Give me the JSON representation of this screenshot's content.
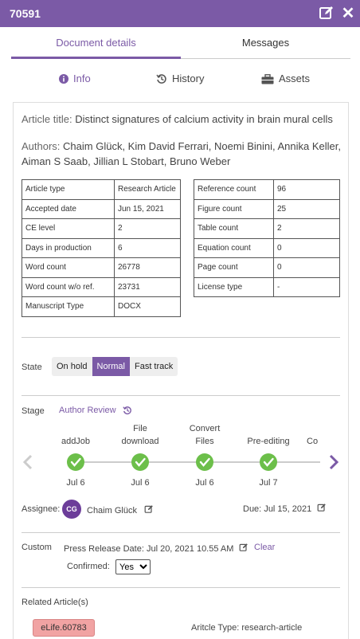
{
  "window": {
    "doc_id": "70591"
  },
  "tabs": [
    {
      "label": "Document details",
      "active": true
    },
    {
      "label": "Messages",
      "active": false
    }
  ],
  "subtabs": [
    {
      "label": "Info",
      "icon": "info-icon",
      "active": true
    },
    {
      "label": "History",
      "icon": "history-icon",
      "active": false
    },
    {
      "label": "Assets",
      "icon": "briefcase-icon",
      "active": false
    }
  ],
  "article": {
    "title_label": "Article title:",
    "title": "Distinct signatures of calcium activity in brain mural cells",
    "authors_label": "Authors:",
    "authors": "Chaim Glück, Kim David Ferrari, Noemi Binini, Annika Keller, Aiman S Saab, Jillian L Stobart, Bruno Weber"
  },
  "left_table": [
    [
      "Article type",
      "Research Article"
    ],
    [
      "Accepted date",
      "Jun 15, 2021"
    ],
    [
      "CE level",
      "2"
    ],
    [
      "Days in production",
      "6"
    ],
    [
      "Word count",
      "26778"
    ],
    [
      "Word count w/o ref.",
      "23731"
    ],
    [
      "Manuscript Type",
      "DOCX"
    ]
  ],
  "right_table": [
    [
      "Reference count",
      "96"
    ],
    [
      "Figure count",
      "25"
    ],
    [
      "Table count",
      "2"
    ],
    [
      "Equation count",
      "0"
    ],
    [
      "Page count",
      "0"
    ],
    [
      "License type",
      "-"
    ]
  ],
  "state": {
    "label": "State",
    "options": [
      "On hold",
      "Normal",
      "Fast track"
    ],
    "selected": "Normal"
  },
  "stage": {
    "label": "Stage",
    "value": "Author Review",
    "steps": [
      {
        "name": [
          "addJob"
        ],
        "date": "Jul 6",
        "done": true
      },
      {
        "name": [
          "File",
          "download"
        ],
        "date": "Jul 6",
        "done": true
      },
      {
        "name": [
          "Convert",
          "Files"
        ],
        "date": "Jul 6",
        "done": true
      },
      {
        "name": [
          "Pre-editing"
        ],
        "date": "Jul 7",
        "done": true
      },
      {
        "name": [
          "Co"
        ],
        "date": "",
        "done": false
      }
    ]
  },
  "assignee": {
    "label": "Assignee:",
    "initials": "CG",
    "name": "Chaim Glück",
    "due_label": "Due:",
    "due_date": "Jul 15, 2021"
  },
  "custom": {
    "label": "Custom",
    "press_release_label": "Press Release Date:",
    "press_release_date": "Jul 20, 2021 10.55 AM",
    "clear_label": "Clear",
    "confirmed_label": "Confirmed:",
    "confirmed_value": "Yes"
  },
  "related": {
    "label": "Related Article(s)",
    "badge": "eLife.60783",
    "type_text": "Aritcle Type: research-article"
  },
  "colors": {
    "accent": "#7b5aa6",
    "done_green": "#6cbf4a",
    "badge_red": "#f1a3a3"
  }
}
